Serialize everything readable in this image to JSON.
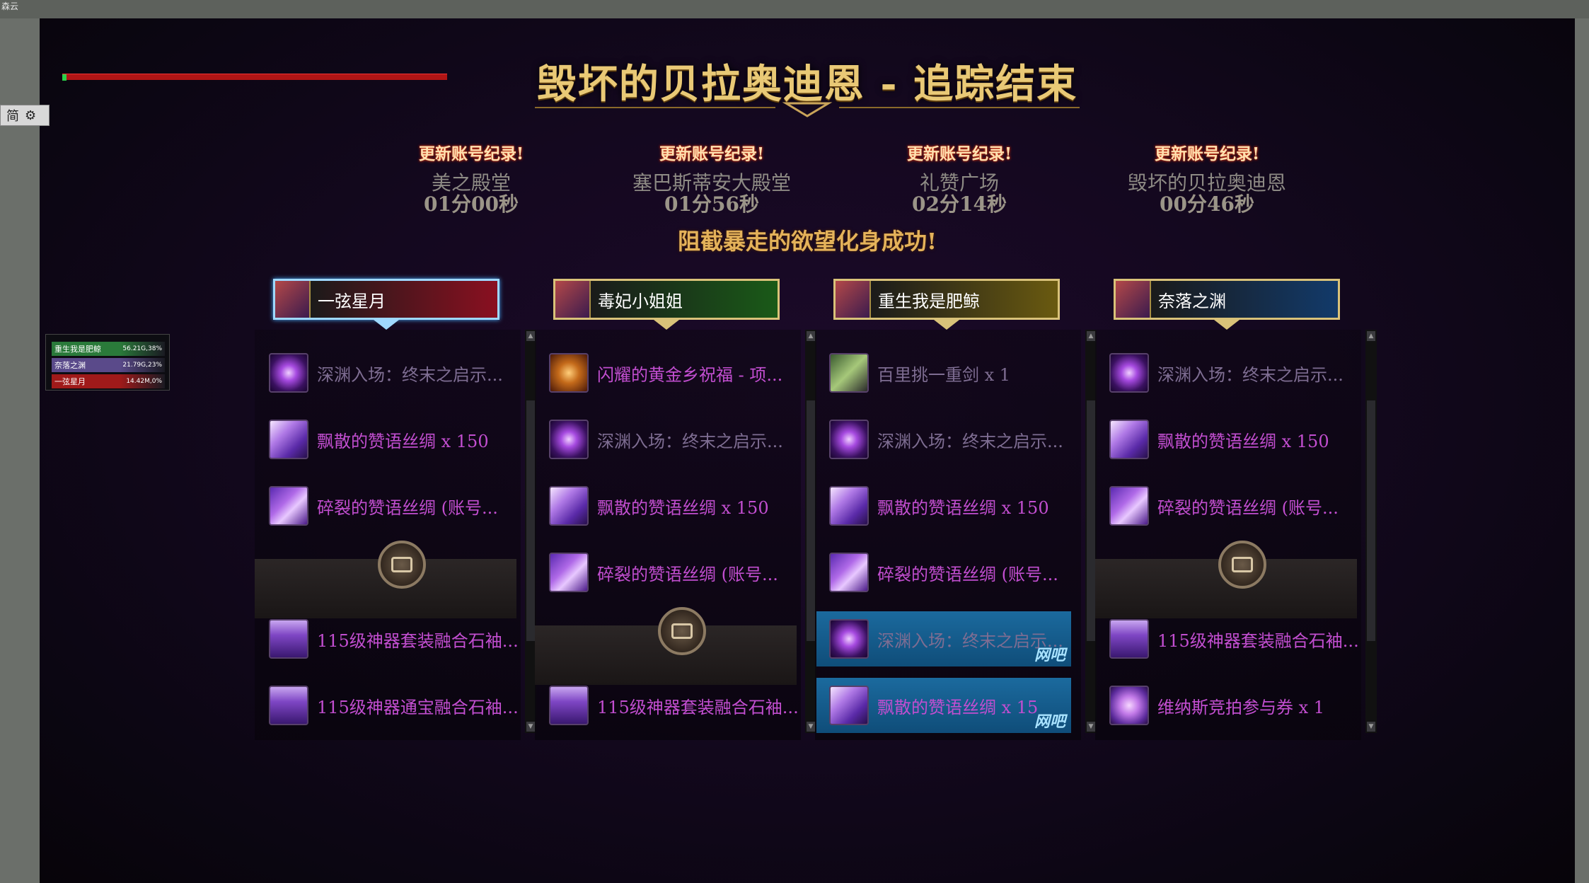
{
  "corner_label": "森云",
  "lang_switch": {
    "label": "简"
  },
  "title": "毁坏的贝拉奥迪恩 - 追踪结束",
  "records": [
    {
      "heading": "更新账号纪录!",
      "place": "美之殿堂",
      "time": "01分00秒"
    },
    {
      "heading": "更新账号纪录!",
      "place": "塞巴斯蒂安大殿堂",
      "time": "01分56秒"
    },
    {
      "heading": "更新账号纪录!",
      "place": "礼赞广场",
      "time": "02分14秒"
    },
    {
      "heading": "更新账号纪录!",
      "place": "毁坏的贝拉奥迪恩",
      "time": "00分46秒"
    }
  ],
  "success_text": "阻截暴走的欲望化身成功!",
  "dps_meter": {
    "rows": [
      {
        "name": "重生我是肥鲸",
        "value": "56.21G,38%",
        "color": "#2a7a3a"
      },
      {
        "name": "奈落之渊",
        "value": "21.79G,23%",
        "color": "#5a4a8a"
      },
      {
        "name": "一弦星月",
        "value": "14.42M,0%",
        "color": "#a01a1a"
      }
    ]
  },
  "players": [
    {
      "name": "一弦星月",
      "selected": true,
      "bar_color": "#8a1020",
      "items_above": [
        {
          "text": "深渊入场：终末之启示...",
          "icon": "ic1",
          "gray": true
        },
        {
          "text": "飘散的赞语丝绸 x 150",
          "icon": "ic2",
          "gray": false
        },
        {
          "text": "碎裂的赞语丝绸 (账号...",
          "icon": "ic3",
          "gray": false
        }
      ],
      "items_below": [
        {
          "text": "115级神器套装融合石袖...",
          "icon": "ic4",
          "gray": false
        },
        {
          "text": "115级神器通宝融合石袖...",
          "icon": "ic4",
          "gray": false
        }
      ]
    },
    {
      "name": "毒妃小姐姐",
      "selected": false,
      "bar_color": "#1a5a18",
      "items_above": [
        {
          "text": "闪耀的黄金乡祝福 - 项...",
          "icon": "ic5",
          "gray": false
        },
        {
          "text": "深渊入场：终末之启示...",
          "icon": "ic1",
          "gray": true
        },
        {
          "text": "飘散的赞语丝绸 x 150",
          "icon": "ic2",
          "gray": false
        },
        {
          "text": "碎裂的赞语丝绸 (账号...",
          "icon": "ic3",
          "gray": false
        }
      ],
      "items_below": [
        {
          "text": "115级神器套装融合石袖...",
          "icon": "ic4",
          "gray": false
        }
      ]
    },
    {
      "name": "重生我是肥鲸",
      "selected": false,
      "bar_color": "#6a5a10",
      "items_above": [
        {
          "text": "百里挑一重剑 x 1",
          "icon": "ic6",
          "gray": true
        },
        {
          "text": "深渊入场：终末之启示...",
          "icon": "ic1",
          "gray": true
        },
        {
          "text": "飘散的赞语丝绸 x 150",
          "icon": "ic2",
          "gray": false
        },
        {
          "text": "碎裂的赞语丝绸 (账号...",
          "icon": "ic3",
          "gray": false
        },
        {
          "text": "深渊入场：终末之启示...",
          "icon": "ic1",
          "gray": true,
          "highlight": true,
          "badge": "网吧"
        },
        {
          "text": "飘散的赞语丝绸 x 15",
          "icon": "ic2",
          "gray": false,
          "highlight": true,
          "badge": "网吧"
        }
      ],
      "items_below": []
    },
    {
      "name": "奈落之渊",
      "selected": false,
      "bar_color": "#123a6a",
      "items_above": [
        {
          "text": "深渊入场：终末之启示...",
          "icon": "ic1",
          "gray": true
        },
        {
          "text": "飘散的赞语丝绸 x 150",
          "icon": "ic2",
          "gray": false
        },
        {
          "text": "碎裂的赞语丝绸 (账号...",
          "icon": "ic3",
          "gray": false
        }
      ],
      "items_below": [
        {
          "text": "115级神器套装融合石袖...",
          "icon": "ic4",
          "gray": false
        },
        {
          "text": "维纳斯竞拍参与券 x 1",
          "icon": "ic7",
          "gray": false
        }
      ]
    }
  ]
}
